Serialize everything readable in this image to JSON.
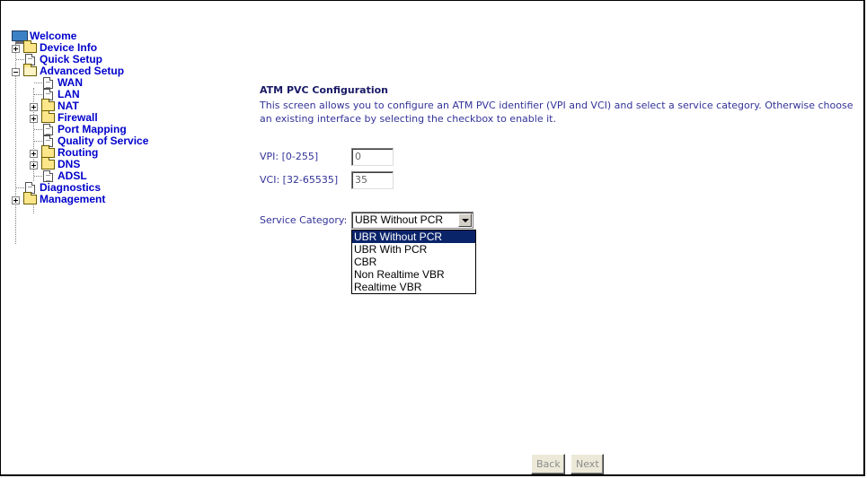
{
  "nav": {
    "root": "Welcome",
    "items": [
      {
        "label": "Device Info"
      },
      {
        "label": "Quick Setup"
      },
      {
        "label": "Advanced Setup"
      },
      {
        "label": "WAN"
      },
      {
        "label": "LAN"
      },
      {
        "label": "NAT"
      },
      {
        "label": "Firewall"
      },
      {
        "label": "Port Mapping"
      },
      {
        "label": "Quality of Service"
      },
      {
        "label": "Routing"
      },
      {
        "label": "DNS"
      },
      {
        "label": "ADSL"
      },
      {
        "label": "Diagnostics"
      },
      {
        "label": "Management"
      }
    ]
  },
  "main": {
    "title": "ATM PVC Configuration",
    "description": "This screen allows you to configure an ATM PVC identifier (VPI and VCI) and select a service category. Otherwise choose an existing interface by selecting the checkbox to enable it.",
    "vpi": {
      "label": "VPI: [0-255]",
      "value": "0"
    },
    "vci": {
      "label": "VCI: [32-65535]",
      "value": "35"
    },
    "service_category": {
      "label": "Service Category:",
      "selected": "UBR Without PCR",
      "options": [
        "UBR Without PCR",
        "UBR With PCR",
        "CBR",
        "Non Realtime VBR",
        "Realtime VBR"
      ]
    },
    "back_label": "Back",
    "next_label": "Next"
  },
  "colors": {
    "nav_text": "#0000cc",
    "main_text": "#333399",
    "selection": "#0a246a"
  }
}
